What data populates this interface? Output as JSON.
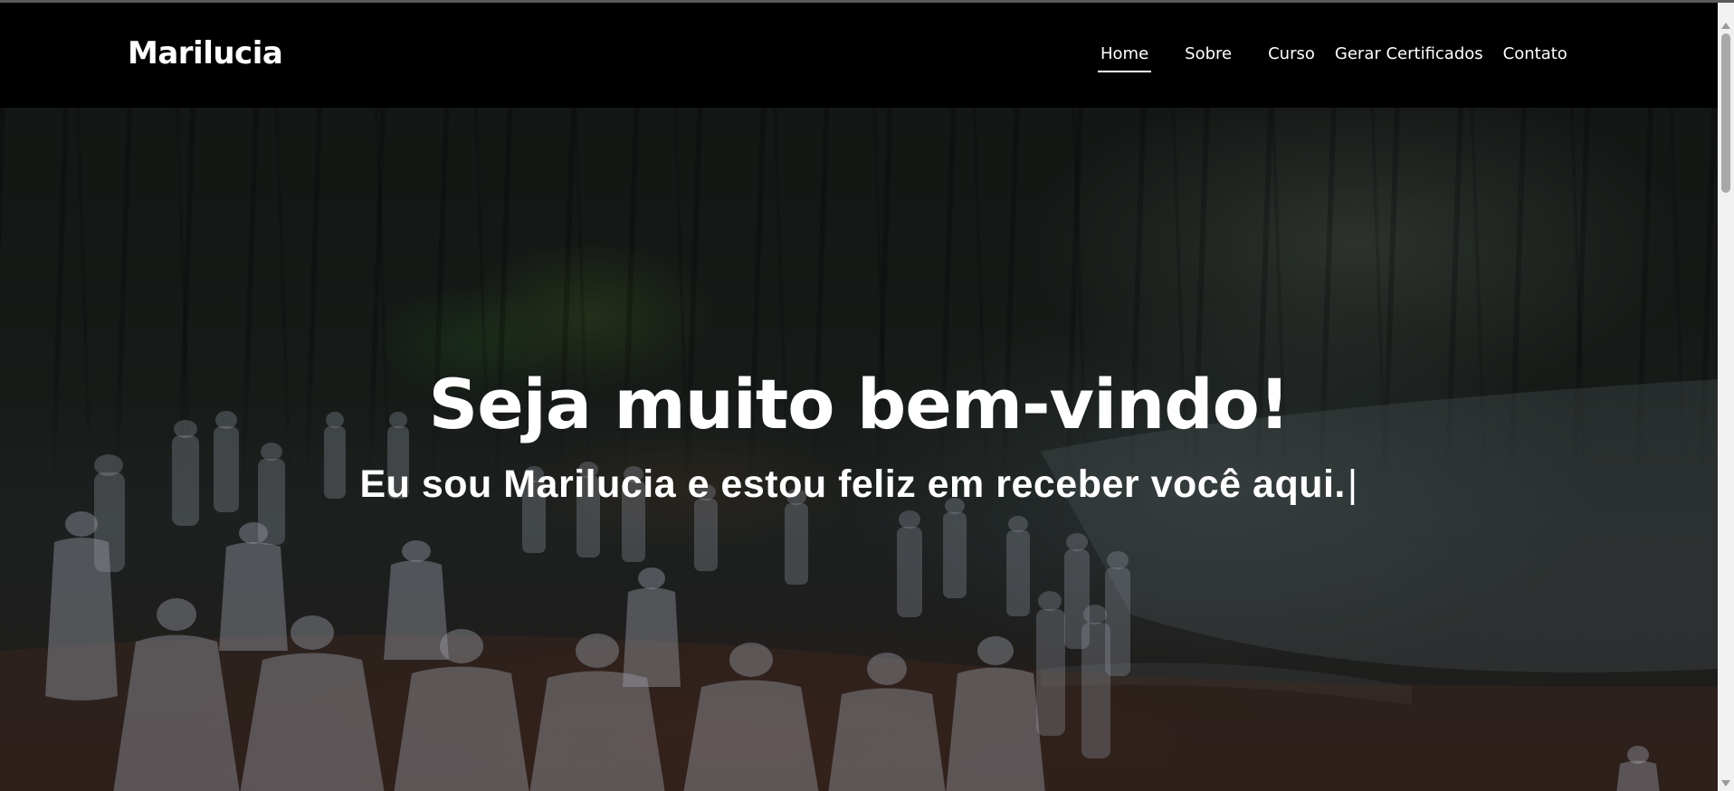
{
  "header": {
    "brand": "Marilucia",
    "nav": [
      {
        "label": "Home",
        "active": true
      },
      {
        "label": "Sobre",
        "active": false
      },
      {
        "label": "Curso",
        "active": false
      },
      {
        "label": "Gerar Certificados",
        "active": false
      },
      {
        "label": "Contato",
        "active": false
      }
    ]
  },
  "hero": {
    "title": "Seja muito bem-vindo!",
    "subtitle": "Eu sou Marilucia e estou feliz em receber você aqui.",
    "caret": "|"
  },
  "colors": {
    "header_bg": "#000000",
    "text": "#ffffff",
    "active_underline": "#ffffff"
  },
  "icons": {
    "scroll_up": "scroll-up-arrow-icon",
    "scroll_down": "scroll-down-arrow-icon"
  }
}
